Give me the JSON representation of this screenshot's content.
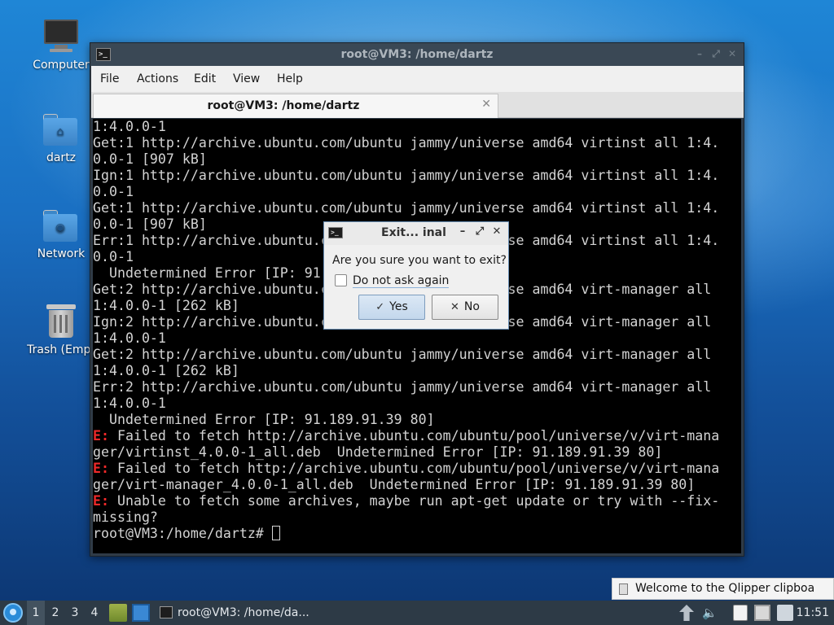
{
  "desktop": {
    "icons": [
      {
        "label": "Computer"
      },
      {
        "label": "dartz"
      },
      {
        "label": "Network"
      },
      {
        "label": "Trash (Empt"
      }
    ]
  },
  "terminal_window": {
    "title": "root@VM3: /home/dartz",
    "menu": [
      "File",
      "Actions",
      "Edit",
      "View",
      "Help"
    ],
    "tab_title": "root@VM3: /home/dartz",
    "lines": [
      {
        "prefix": "",
        "text": "1:4.0.0-1"
      },
      {
        "prefix": "",
        "text": "Get:1 http://archive.ubuntu.com/ubuntu jammy/universe amd64 virtinst all 1:4."
      },
      {
        "prefix": "",
        "text": "0.0-1 [907 kB]"
      },
      {
        "prefix": "",
        "text": "Ign:1 http://archive.ubuntu.com/ubuntu jammy/universe amd64 virtinst all 1:4."
      },
      {
        "prefix": "",
        "text": "0.0-1"
      },
      {
        "prefix": "",
        "text": "Get:1 http://archive.ubuntu.com/ubuntu jammy/universe amd64 virtinst all 1:4."
      },
      {
        "prefix": "",
        "text": "0.0-1 [907 kB]"
      },
      {
        "prefix": "",
        "text": "Err:1 http://archive.ubuntu.com/ubuntu jammy/universe amd64 virtinst all 1:4."
      },
      {
        "prefix": "",
        "text": "0.0-1"
      },
      {
        "prefix": "",
        "text": "  Undetermined Error [IP: 91.189.91.39 80]"
      },
      {
        "prefix": "",
        "text": "Get:2 http://archive.ubuntu.com/ubuntu jammy/universe amd64 virt-manager all"
      },
      {
        "prefix": "",
        "text": "1:4.0.0-1 [262 kB]"
      },
      {
        "prefix": "",
        "text": "Ign:2 http://archive.ubuntu.com/ubuntu jammy/universe amd64 virt-manager all"
      },
      {
        "prefix": "",
        "text": "1:4.0.0-1"
      },
      {
        "prefix": "",
        "text": "Get:2 http://archive.ubuntu.com/ubuntu jammy/universe amd64 virt-manager all"
      },
      {
        "prefix": "",
        "text": "1:4.0.0-1 [262 kB]"
      },
      {
        "prefix": "",
        "text": "Err:2 http://archive.ubuntu.com/ubuntu jammy/universe amd64 virt-manager all"
      },
      {
        "prefix": "",
        "text": "1:4.0.0-1"
      },
      {
        "prefix": "",
        "text": "  Undetermined Error [IP: 91.189.91.39 80]"
      },
      {
        "prefix": "E:",
        "text": " Failed to fetch http://archive.ubuntu.com/ubuntu/pool/universe/v/virt-mana"
      },
      {
        "prefix": "",
        "text": "ger/virtinst_4.0.0-1_all.deb  Undetermined Error [IP: 91.189.91.39 80]"
      },
      {
        "prefix": "E:",
        "text": " Failed to fetch http://archive.ubuntu.com/ubuntu/pool/universe/v/virt-mana"
      },
      {
        "prefix": "",
        "text": "ger/virt-manager_4.0.0-1_all.deb  Undetermined Error [IP: 91.189.91.39 80]"
      },
      {
        "prefix": "E:",
        "text": " Unable to fetch some archives, maybe run apt-get update or try with --fix-"
      },
      {
        "prefix": "",
        "text": "missing?"
      }
    ],
    "prompt": "root@VM3:/home/dartz# "
  },
  "dialog": {
    "title": "Exit... inal",
    "question": "Are you sure you want to exit?",
    "checkbox_label": "Do not ask again",
    "checkbox_checked": false,
    "yes_label": "Yes",
    "no_label": "No"
  },
  "notification": {
    "text": "Welcome to the Qlipper clipboa"
  },
  "panel": {
    "workspaces": [
      "1",
      "2",
      "3",
      "4"
    ],
    "active_workspace": "1",
    "task_label": "root@VM3: /home/da...",
    "clock": "11:51"
  },
  "colors": {
    "error_red": "#ef2929",
    "terminal_bg": "#000000",
    "terminal_fg": "#d3d3d3",
    "panel_bg": "#2d3a46"
  }
}
